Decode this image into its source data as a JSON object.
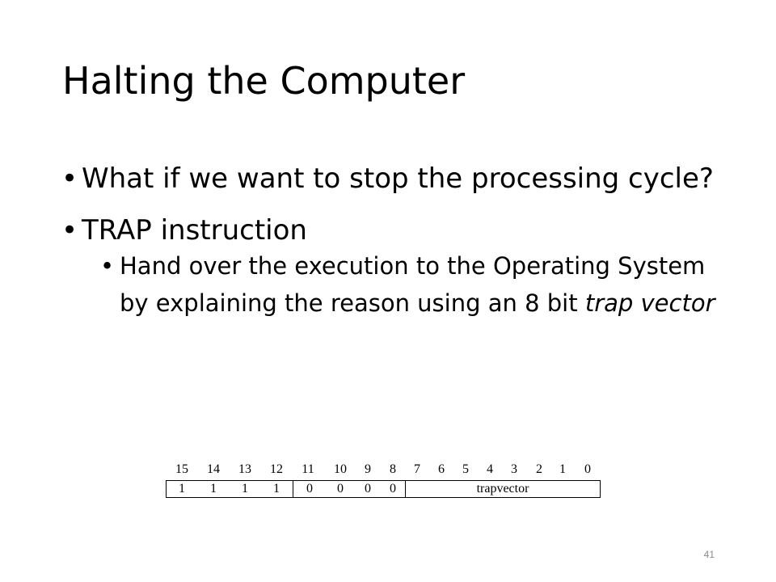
{
  "slide": {
    "title": "Halting the Computer",
    "bullets": [
      {
        "text": "What if we want to stop the processing cycle?"
      },
      {
        "text": "TRAP instruction",
        "sub_bullets": [
          {
            "text_before": "Hand over the execution to the Operating System by explaining the reason using an 8 bit ",
            "text_emphasis": "trap vector"
          }
        ]
      }
    ],
    "instruction_format": {
      "bit_numbers": [
        "15",
        "14",
        "13",
        "12",
        "11",
        "10",
        "9",
        "8",
        "7",
        "6",
        "5",
        "4",
        "3",
        "2",
        "1",
        "0"
      ],
      "opcode_bits": [
        "1",
        "1",
        "1",
        "1"
      ],
      "reserved_bits": [
        "0",
        "0",
        "0",
        "0"
      ],
      "trapvector_label": "trapvector"
    },
    "page_number": "41"
  }
}
